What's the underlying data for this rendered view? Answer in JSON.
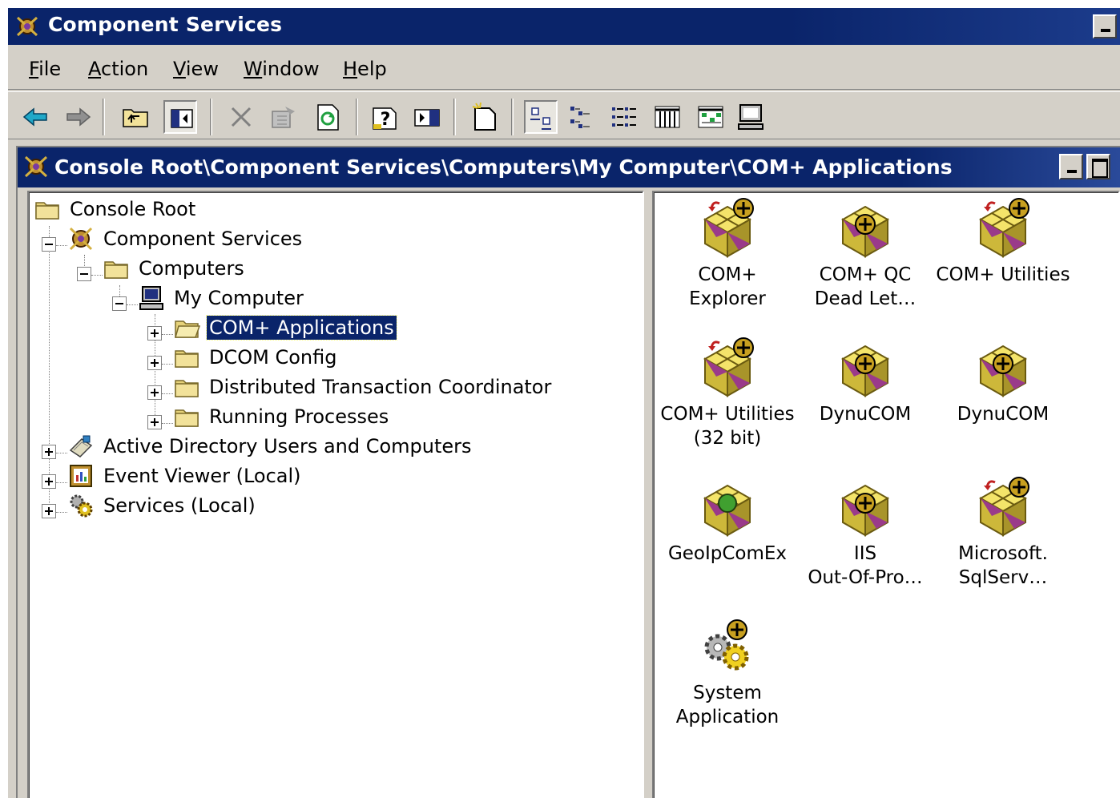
{
  "window": {
    "title": "Component Services"
  },
  "menu": [
    {
      "label": "File",
      "accel": "F",
      "rest": "ile"
    },
    {
      "label": "Action",
      "accel": "A",
      "rest": "ction"
    },
    {
      "label": "View",
      "accel": "V",
      "rest": "iew"
    },
    {
      "label": "Window",
      "accel": "W",
      "rest": "indow"
    },
    {
      "label": "Help",
      "accel": "H",
      "rest": "elp"
    }
  ],
  "toolbar": {
    "buttons": [
      "back-icon",
      "forward-icon",
      "up-folder-icon",
      "show-hide-tree-icon",
      "delete-icon",
      "properties-icon",
      "refresh-icon",
      "help-icon",
      "show-hide-action-pane-icon",
      "new-window-icon",
      "large-icons-view-icon",
      "small-icons-view-icon",
      "list-view-icon",
      "detail-view-icon",
      "status-view-icon",
      "computer-icon"
    ]
  },
  "child_window": {
    "title": "Console Root\\Component Services\\Computers\\My Computer\\COM+ Applications"
  },
  "tree": {
    "root": "Console Root",
    "component_services": "Component Services",
    "computers": "Computers",
    "my_computer": "My Computer",
    "com_apps": "COM+ Applications",
    "dcom": "DCOM Config",
    "dtc": "Distributed Transaction Coordinator",
    "running": "Running Processes",
    "ad": "Active Directory Users and Computers",
    "event": "Event Viewer (Local)",
    "services": "Services (Local)"
  },
  "apps": [
    {
      "label": "COM+\nExplorer",
      "icon": "com-app-arrow"
    },
    {
      "label": "COM+ QC\nDead Let…",
      "icon": "com-app"
    },
    {
      "label": "COM+ Utilities",
      "icon": "com-app-arrow"
    },
    {
      "label": "COM+ Utilities\n(32 bit)",
      "icon": "com-app-arrow"
    },
    {
      "label": "DynuCOM",
      "icon": "com-app"
    },
    {
      "label": "DynuCOM",
      "icon": "com-app"
    },
    {
      "label": "GeoIpComEx",
      "icon": "com-app-green"
    },
    {
      "label": "IIS\nOut-Of-Pro…",
      "icon": "com-app"
    },
    {
      "label": "Microsoft.\nSqlServ…",
      "icon": "com-app-arrow"
    },
    {
      "label": "System\nApplication",
      "icon": "system-gears"
    }
  ],
  "colors": {
    "titlebar": "#0a246a",
    "face": "#d4d0c8",
    "selection": "#0a246a"
  }
}
